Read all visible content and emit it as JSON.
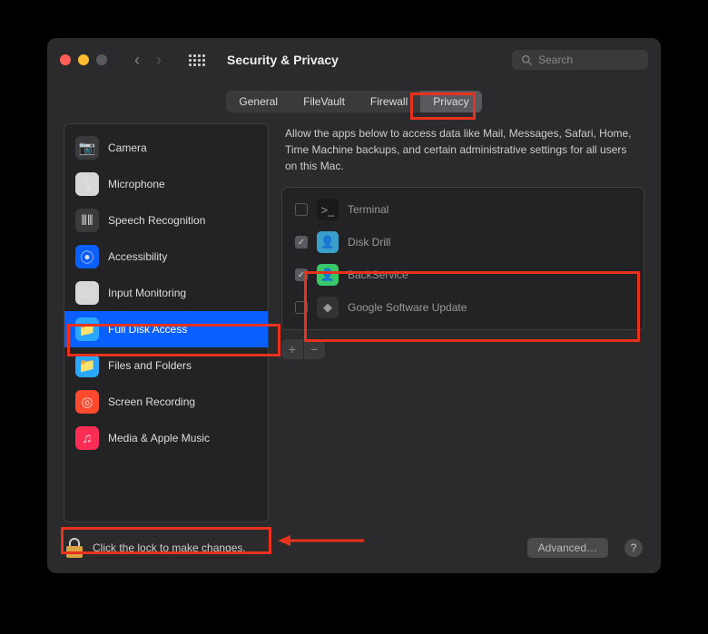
{
  "colors": {
    "close": "#ff5f57",
    "min": "#febc2e",
    "max": "#5a5a5e",
    "accent": "#0a60ff",
    "highlight": "#e8321e"
  },
  "title": "Security & Privacy",
  "search": {
    "placeholder": "Search"
  },
  "tabs": [
    {
      "label": "General",
      "active": false
    },
    {
      "label": "FileVault",
      "active": false
    },
    {
      "label": "Firewall",
      "active": false
    },
    {
      "label": "Privacy",
      "active": true
    }
  ],
  "sidebar": [
    {
      "label": "Camera",
      "icon_bg": "#3b3b3d",
      "glyph": "📷"
    },
    {
      "label": "Microphone",
      "icon_bg": "#d7d7d9",
      "glyph": "🎙"
    },
    {
      "label": "Speech Recognition",
      "icon_bg": "#3b3b3d",
      "glyph": "⦀⦀"
    },
    {
      "label": "Accessibility",
      "icon_bg": "#0a60ff",
      "glyph": "⦿"
    },
    {
      "label": "Input Monitoring",
      "icon_bg": "#d7d7d9",
      "glyph": "⌨"
    },
    {
      "label": "Full Disk Access",
      "icon_bg": "#2aa7ff",
      "glyph": "📁",
      "selected": true
    },
    {
      "label": "Files and Folders",
      "icon_bg": "#2aa7ff",
      "glyph": "📁"
    },
    {
      "label": "Screen Recording",
      "icon_bg": "#ff4a2e",
      "glyph": "◎"
    },
    {
      "label": "Media & Apple Music",
      "icon_bg": "#ff2d55",
      "glyph": "♫"
    }
  ],
  "description": "Allow the apps below to access data like Mail, Messages, Safari, Home, Time Machine backups, and certain administrative settings for all users on this Mac.",
  "apps": [
    {
      "name": "Terminal",
      "checked": false,
      "icon_bg": "#1a1a1c",
      "glyph": ">_"
    },
    {
      "name": "Disk Drill",
      "checked": true,
      "icon_bg": "#3aa0c9",
      "glyph": "👤"
    },
    {
      "name": "BackService",
      "checked": true,
      "icon_bg": "#3ac96a",
      "glyph": "👤"
    },
    {
      "name": "Google Software Update",
      "checked": false,
      "icon_bg": "#333",
      "glyph": "◆"
    }
  ],
  "lock_text": "Click the lock to make changes.",
  "advanced_label": "Advanced…",
  "help_label": "?"
}
